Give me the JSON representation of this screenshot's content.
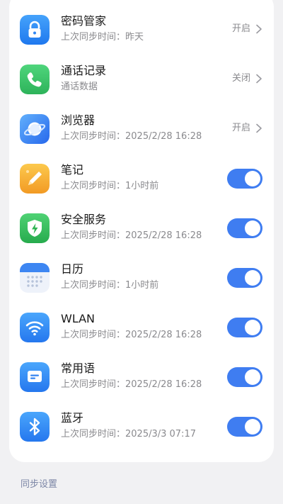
{
  "rows": [
    {
      "title": "密码管家",
      "subtitle": "上次同步时间：昨天",
      "status": "开启",
      "icon": "lock-icon",
      "color": "#2f8cf5"
    },
    {
      "title": "通话记录",
      "subtitle": "通话数据",
      "status": "关闭",
      "icon": "phone-icon",
      "color": "#38c46a"
    },
    {
      "title": "浏览器",
      "subtitle": "上次同步时间：2025/2/28 16:28",
      "status": "开启",
      "icon": "browser-planet-icon",
      "color": "#3d86f2"
    },
    {
      "title": "笔记",
      "subtitle": "上次同步时间：1小时前",
      "toggle": "on",
      "icon": "notes-pencil-icon",
      "color": "#f5b43a"
    },
    {
      "title": "安全服务",
      "subtitle": "上次同步时间：2025/2/28 16:28",
      "toggle": "on",
      "icon": "shield-bolt-icon",
      "color": "#3dbf5e"
    },
    {
      "title": "日历",
      "subtitle": "上次同步时间：1小时前",
      "toggle": "on",
      "icon": "calendar-icon",
      "color": "#3d86f2"
    },
    {
      "title": "WLAN",
      "subtitle": "上次同步时间：2025/2/28 16:28",
      "toggle": "on",
      "icon": "wifi-icon",
      "color": "#3d86f2"
    },
    {
      "title": "常用语",
      "subtitle": "上次同步时间：2025/2/28 16:28",
      "toggle": "on",
      "icon": "message-icon",
      "color": "#3d86f2"
    },
    {
      "title": "蓝牙",
      "subtitle": "上次同步时间：2025/3/3 07:17",
      "toggle": "on",
      "icon": "bluetooth-icon",
      "color": "#3d86f2"
    }
  ],
  "section_label": "同步设置",
  "colors": {
    "toggle_on": "#3f7df1",
    "background": "#f1f1f3"
  }
}
